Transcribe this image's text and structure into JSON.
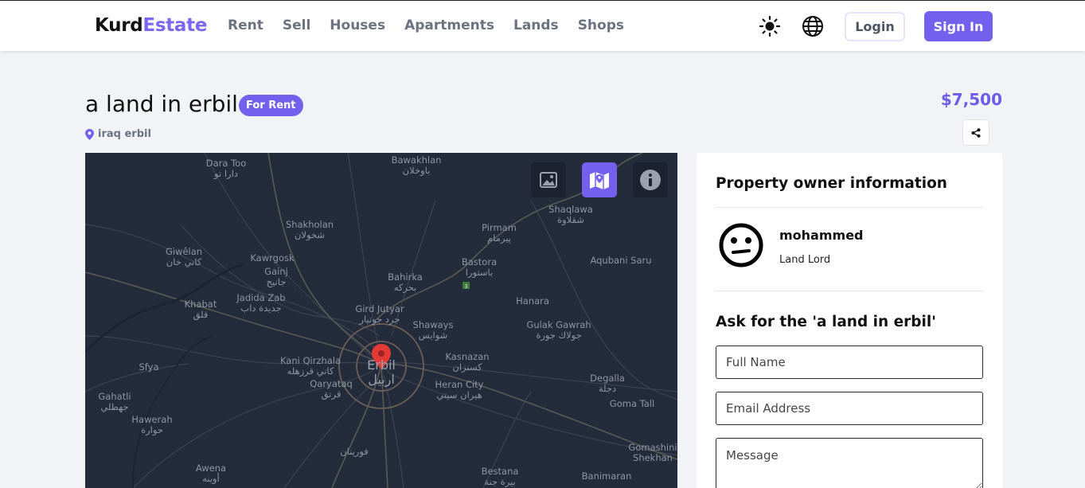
{
  "brand": {
    "part1": "Kurd",
    "part2": "Estate"
  },
  "nav": {
    "links": [
      "Rent",
      "Sell",
      "Houses",
      "Apartments",
      "Lands",
      "Shops"
    ],
    "login": "Login",
    "signin": "Sign In"
  },
  "listing": {
    "title": "a land in erbil",
    "badge": "For Rent",
    "location": "iraq erbil",
    "price": "$7,500"
  },
  "map": {
    "labels": [
      {
        "text": "Dara Too",
        "sub": "دارا تو"
      },
      {
        "text": "Bawakhlan",
        "sub": "باوخلان"
      },
      {
        "text": "Shakholan",
        "sub": "شخولان"
      },
      {
        "text": "Pirmam",
        "sub": "پیرمام"
      },
      {
        "text": "Shaqlawa",
        "sub": "شقلاوة"
      },
      {
        "text": "Giwêlan",
        "sub": "كاني خان"
      },
      {
        "text": "Kawrgosk",
        "sub": ""
      },
      {
        "text": "Gainj",
        "sub": "جانيج"
      },
      {
        "text": "Bastora",
        "sub": "باستورا"
      },
      {
        "text": "Aqubani Saru",
        "sub": ""
      },
      {
        "text": "Bahirka",
        "sub": "بحركه"
      },
      {
        "text": "Jadida Zab",
        "sub": "جديدة داب"
      },
      {
        "text": "Khabat",
        "sub": "قلق"
      },
      {
        "text": "Gird Jutyar",
        "sub": "جرد جوتيار"
      },
      {
        "text": "Hanara",
        "sub": ""
      },
      {
        "text": "Shaways",
        "sub": "شوايس"
      },
      {
        "text": "Gulak Gawrah",
        "sub": "جولاك جورة"
      },
      {
        "text": "Kani Qirzhala",
        "sub": "كاني قرزهله"
      },
      {
        "text": "Kasnazan",
        "sub": "كسنزان"
      },
      {
        "text": "Sfya",
        "sub": ""
      },
      {
        "text": "Qaryataq",
        "sub": "قرتق"
      },
      {
        "text": "Heran City",
        "sub": "هيران سيتي"
      },
      {
        "text": "Degalla",
        "sub": "دجلة"
      },
      {
        "text": "Gahatli",
        "sub": "جهطلي"
      },
      {
        "text": "Goma Tall",
        "sub": ""
      },
      {
        "text": "Hawerah",
        "sub": "حوارة"
      },
      {
        "text": "Gomashini",
        "sub": "Shekhan"
      },
      {
        "text": "Awena",
        "sub": "أوينه"
      },
      {
        "text": "Bestana",
        "sub": "بيرة جنة"
      },
      {
        "text": "Banimaran",
        "sub": ""
      },
      {
        "text": "Erbil",
        "sub": "اربيل"
      },
      {
        "text": "فورينان",
        "sub": ""
      }
    ],
    "controls": {
      "gallery": "image-icon",
      "map": "map-icon",
      "info": "info-icon"
    }
  },
  "owner": {
    "heading": "Property owner information",
    "name": "mohammed",
    "role": "Land Lord",
    "ask_heading": "Ask for the 'a land in erbil'",
    "form": {
      "full_name": "Full Name",
      "email": "Email Address",
      "message": "Message"
    }
  },
  "colors": {
    "accent": "#7361ee",
    "map_bg": "#242b3a",
    "pin": "#e53935"
  }
}
